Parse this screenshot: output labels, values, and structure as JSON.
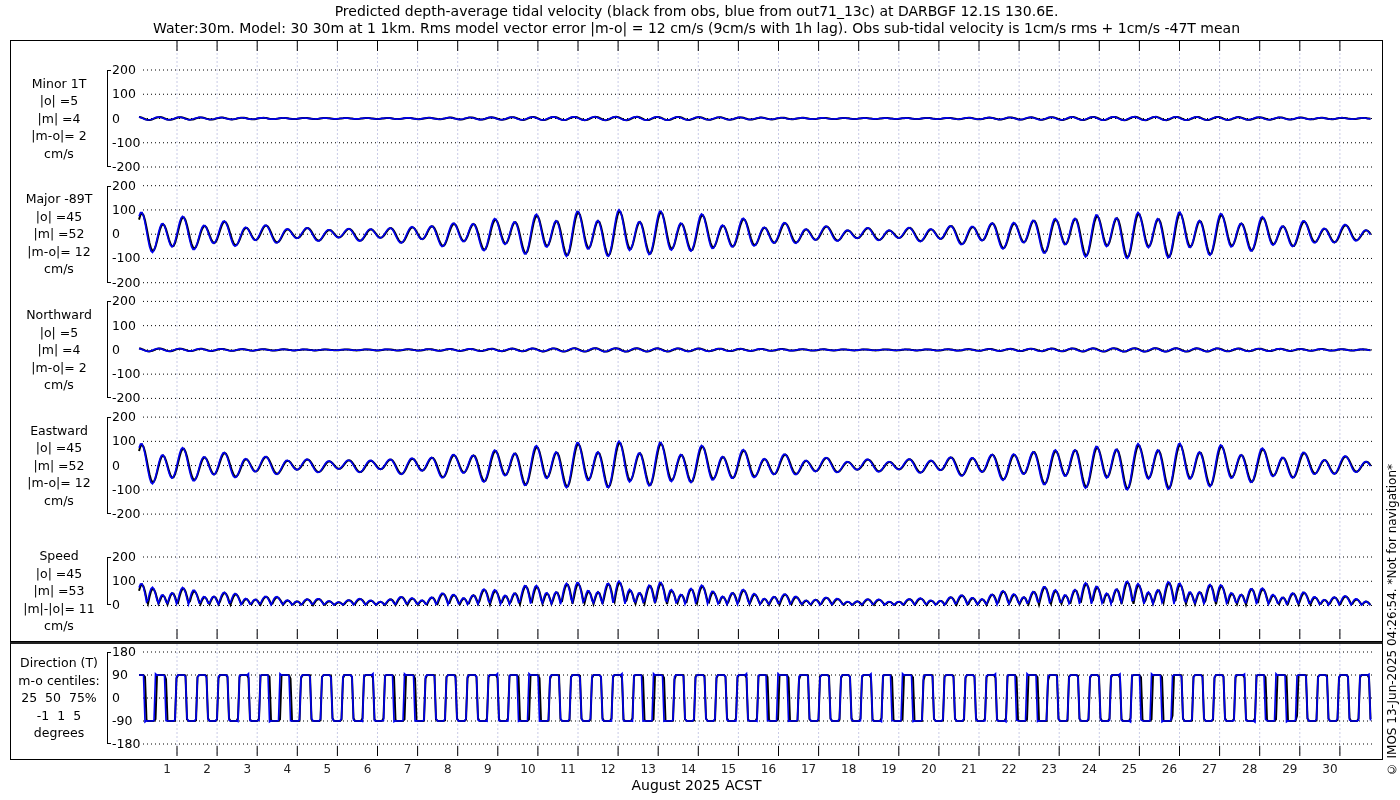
{
  "title_lines": [
    "Predicted depth-average tidal velocity (black from obs, blue from out71_13c) at DARBGF 12.1S 130.6E.",
    "Water:30m. Model: 30 30m at 1 1km. Rms model vector error |m-o| = 12 cm/s (9cm/s with 1h lag). Obs sub-tidal velocity is 1cm/s rms + 1cm/s -47T mean"
  ],
  "panels": [
    {
      "kind": "minor",
      "label_lines": [
        "Minor 1T",
        "|o| =5",
        "|m| =4",
        "|m-o|= 2",
        "cm/s"
      ],
      "yticks": [
        "200",
        "100",
        "0",
        "-100",
        "-200"
      ]
    },
    {
      "kind": "major",
      "label_lines": [
        "Major -89T",
        "|o| =45",
        "|m| =52",
        "|m-o|= 12",
        "cm/s"
      ],
      "yticks": [
        "200",
        "100",
        "0",
        "-100",
        "-200"
      ]
    },
    {
      "kind": "minor",
      "label_lines": [
        "Northward",
        "|o| =5",
        "|m| =4",
        "|m-o|= 2",
        "cm/s"
      ],
      "yticks": [
        "200",
        "100",
        "0",
        "-100",
        "-200"
      ]
    },
    {
      "kind": "major",
      "label_lines": [
        "Eastward",
        "|o| =45",
        "|m| =52",
        "|m-o|= 12",
        "cm/s"
      ],
      "yticks": [
        "200",
        "100",
        "0",
        "-100",
        "-200"
      ]
    },
    {
      "kind": "speed",
      "label_lines": [
        "Speed",
        "|o| =45",
        "|m| =53",
        "|m|-|o|= 11",
        "cm/s"
      ],
      "yticks": [
        "200",
        "100",
        "0"
      ]
    }
  ],
  "direction_panel": {
    "kind": "direction",
    "label_lines": [
      "Direction (T)",
      "m-o centiles:",
      "25  50  75%",
      "-1  1  5",
      "degrees"
    ],
    "yticks": [
      "180",
      "90",
      "0",
      "-90",
      "-180"
    ]
  },
  "x_axis": {
    "day_labels": [
      "1",
      "2",
      "3",
      "4",
      "5",
      "6",
      "7",
      "8",
      "9",
      "10",
      "11",
      "12",
      "13",
      "14",
      "15",
      "16",
      "17",
      "18",
      "19",
      "20",
      "21",
      "22",
      "23",
      "24",
      "25",
      "26",
      "27",
      "28",
      "29",
      "30"
    ],
    "xlabel": "August 2025 ACST"
  },
  "credit": "© IMOS 13-Jun-2025 04:26:54. *Not for navigation*"
}
